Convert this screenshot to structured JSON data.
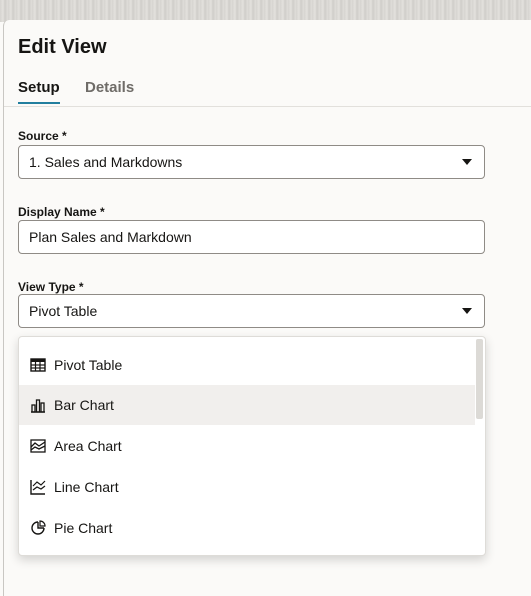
{
  "dialog": {
    "title": "Edit View"
  },
  "tabs": [
    {
      "label": "Setup",
      "active": true
    },
    {
      "label": "Details",
      "active": false
    }
  ],
  "form": {
    "source": {
      "label": "Source *",
      "value": "1. Sales and Markdowns"
    },
    "display_name": {
      "label": "Display Name *",
      "value": "Plan Sales and Markdown"
    },
    "view_type": {
      "label": "View Type *",
      "value": "Pivot Table",
      "options": [
        {
          "label": "Pivot Table",
          "icon": "table-icon"
        },
        {
          "label": "Bar Chart",
          "icon": "bar-chart-icon",
          "hovered": true
        },
        {
          "label": "Area Chart",
          "icon": "area-chart-icon"
        },
        {
          "label": "Line Chart",
          "icon": "line-chart-icon"
        },
        {
          "label": "Pie Chart",
          "icon": "pie-chart-icon"
        }
      ]
    }
  },
  "colors": {
    "accent": "#227e9e",
    "text": "#161513",
    "muted": "#6f6c68",
    "hover_row": "#f1efed"
  }
}
